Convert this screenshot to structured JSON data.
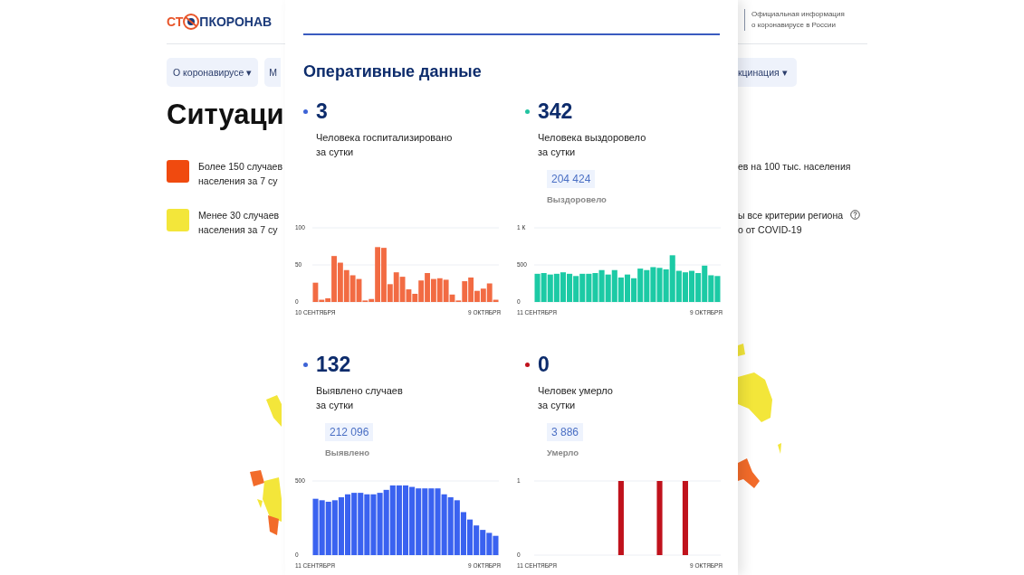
{
  "header": {
    "logo": {
      "part_1": "СТ",
      "part_2": "ПКОРОНАВ"
    },
    "info": [
      "Официальная информация",
      "о коронавирусе в России"
    ]
  },
  "nav": [
    {
      "label": "О коронавирусе ▾"
    },
    {
      "label": "М"
    },
    {
      "label": "кцинация ▾"
    }
  ],
  "heading": "Ситуаци",
  "legend": [
    {
      "color": "#f04a0f",
      "text_left": [
        "Более 150 случаев",
        "населения за 7 су"
      ],
      "text_right": [
        "ев на 100 тыс. населения"
      ],
      "help_icon": false
    },
    {
      "color": "#f3e63a",
      "text_left": [
        "Менее 30 случаев",
        "населения за 7 су"
      ],
      "text_right": [
        "ы все критерии региона",
        "о от COVID-19"
      ],
      "help_icon": true
    }
  ],
  "panel": {
    "title": "Оперативные данные",
    "stats": [
      {
        "value": "3",
        "color": "#3d63d6",
        "label": [
          "Человека госпитализировано",
          "за сутки"
        ],
        "x_start": "10 СЕНТЯБРЯ",
        "x_end": "9 ОКТЯБРЯ",
        "chart_data": {
          "type": "bar",
          "ylim": [
            0,
            100
          ],
          "yticks": [
            0,
            50,
            100
          ],
          "series": [
            {
              "color": "#f26b43",
              "values": [
                26,
                3,
                5,
                62,
                53,
                43,
                36,
                31,
                2,
                4,
                74,
                73,
                24,
                40,
                34,
                17,
                11,
                29,
                39,
                31,
                32,
                30,
                10,
                2,
                28,
                33,
                15,
                18,
                25,
                3
              ]
            }
          ]
        }
      },
      {
        "value": "342",
        "color": "#22c3a0",
        "label": [
          "Человека выздоровело",
          "за сутки"
        ],
        "total": "204 424",
        "total_label": "Выздоровело",
        "y_top": "1 К",
        "x_start": "11 СЕНТЯБРЯ",
        "x_end": "9 ОКТЯБРЯ",
        "chart_data": {
          "type": "bar",
          "ylim": [
            0,
            1000
          ],
          "yticks": [
            0,
            500
          ],
          "series": [
            {
              "color": "#1ccaa5",
              "values": [
                380,
                390,
                370,
                380,
                400,
                380,
                350,
                380,
                380,
                390,
                430,
                370,
                430,
                330,
                370,
                320,
                450,
                430,
                470,
                460,
                440,
                630,
                420,
                400,
                420,
                390,
                490,
                360,
                350
              ]
            }
          ]
        }
      },
      {
        "value": "132",
        "color": "#3d63d6",
        "label": [
          "Выявлено случаев",
          "за сутки"
        ],
        "total": "212 096",
        "total_label": "Выявлено",
        "x_start": "11 СЕНТЯБРЯ",
        "x_end": "9 ОКТЯБРЯ",
        "chart_data": {
          "type": "bar",
          "ylim": [
            0,
            500
          ],
          "yticks": [
            0,
            500
          ],
          "series": [
            {
              "color": "#3a62f0",
              "values": [
                380,
                370,
                360,
                370,
                390,
                410,
                420,
                420,
                410,
                410,
                420,
                440,
                470,
                470,
                470,
                460,
                450,
                450,
                450,
                450,
                410,
                390,
                370,
                290,
                240,
                200,
                170,
                150,
                130
              ]
            }
          ]
        }
      },
      {
        "value": "0",
        "color": "#c0121c",
        "label": [
          "Человек умерло",
          "за сутки"
        ],
        "total": "3 886",
        "total_label": "Умерло",
        "x_start": "11 СЕНТЯБРЯ",
        "x_end": "9 ОКТЯБРЯ",
        "chart_data": {
          "type": "bar",
          "ylim": [
            0,
            1
          ],
          "yticks": [
            0,
            1
          ],
          "series": [
            {
              "color": "#c0121c",
              "values": [
                0,
                0,
                0,
                0,
                0,
                0,
                0,
                0,
                0,
                0,
                0,
                0,
                0,
                1,
                0,
                0,
                0,
                0,
                0,
                1,
                0,
                0,
                0,
                1,
                0,
                0,
                0,
                0,
                0
              ]
            }
          ]
        }
      }
    ]
  }
}
